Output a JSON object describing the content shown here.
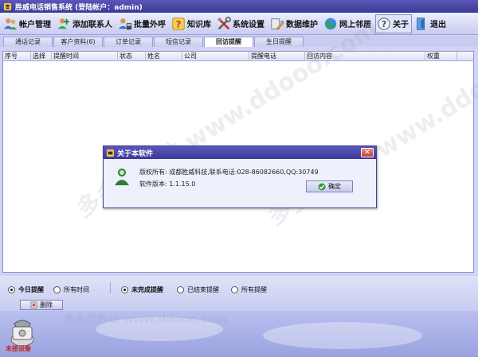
{
  "window": {
    "title": "胜威电话销售系统 (登陆帐户：admin)"
  },
  "toolbar": {
    "buttons": [
      {
        "label": "帐户管理",
        "icon": "users-icon"
      },
      {
        "label": "添加联系人",
        "icon": "add-contact-icon"
      },
      {
        "label": "批量外呼",
        "icon": "batch-call-icon"
      },
      {
        "label": "知识库",
        "icon": "help-icon"
      },
      {
        "label": "系统设置",
        "icon": "tools-icon"
      },
      {
        "label": "数据维护",
        "icon": "maintenance-icon"
      },
      {
        "label": "网上邻居",
        "icon": "globe-icon"
      },
      {
        "label": "关于",
        "icon": "about-icon"
      },
      {
        "label": "退出",
        "icon": "exit-door-icon"
      }
    ],
    "active_index": 7
  },
  "tabs": [
    {
      "label": "通话记录"
    },
    {
      "label": "客户资料(6)"
    },
    {
      "label": "订单记录"
    },
    {
      "label": "短信记录"
    },
    {
      "label": "回访提醒"
    },
    {
      "label": "生日提醒"
    }
  ],
  "active_tab": 4,
  "table": {
    "columns": [
      "序号",
      "选择",
      "提醒时间",
      "状态",
      "姓名",
      "公司",
      "提醒电话",
      "回访内容",
      "权重"
    ],
    "rows": []
  },
  "watermark": "多多软件站 www.ddooo.com",
  "dialog": {
    "title": "关于本软件",
    "copyright": "版权所有: 成都胜威科技,联系电话:028-86082660,QQ:30749",
    "version": "软件版本: 1.1.15.0",
    "ok_label": "确定"
  },
  "filters": {
    "time": [
      {
        "label": "今日提醒",
        "checked": true
      },
      {
        "label": "所有时间",
        "checked": false
      }
    ],
    "status": [
      {
        "label": "未完成提醒",
        "checked": true
      },
      {
        "label": "已结束提醒",
        "checked": false
      },
      {
        "label": "所有提醒",
        "checked": false
      }
    ]
  },
  "delete_label": "删除",
  "device_status": "未接设备",
  "colors": {
    "title_bar": "#3b3a96",
    "toolbar_bg": "#dde0f8",
    "accent": "#5a57b8",
    "device_label": "#c1271d"
  }
}
